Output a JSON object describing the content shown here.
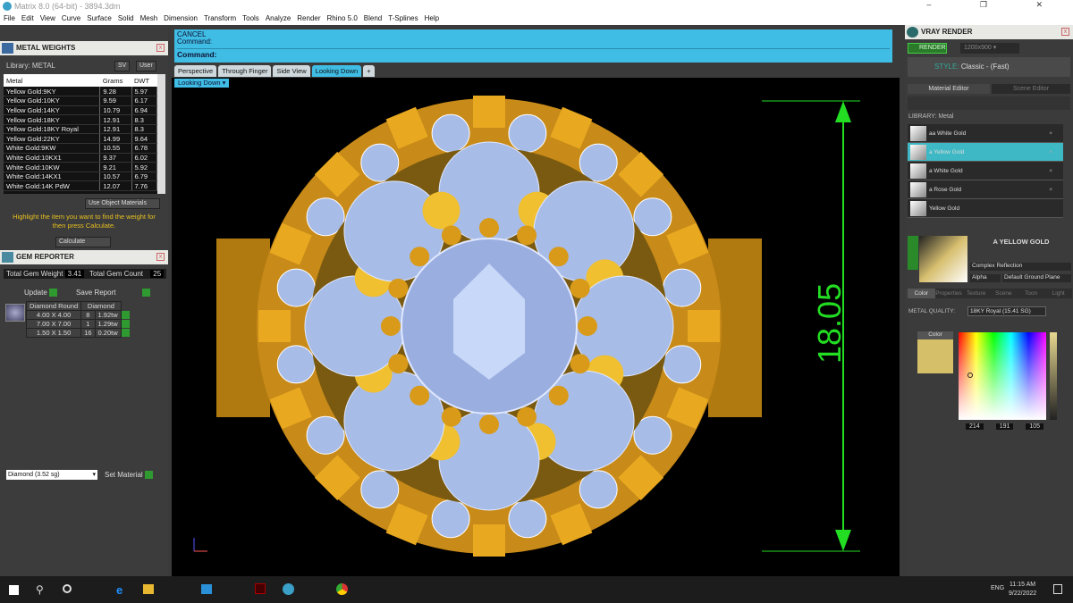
{
  "window": {
    "title": "Matrix 8.0 (64-bit) - 3894.3dm",
    "controls": "– ❐ ✕"
  },
  "menu": [
    "File",
    "Edit",
    "View",
    "Curve",
    "Surface",
    "Solid",
    "Mesh",
    "Dimension",
    "Transform",
    "Tools",
    "Analyze",
    "Render",
    "Rhino 5.0",
    "Blend",
    "T-Splines",
    "Help"
  ],
  "metal_weights": {
    "title": "METAL WEIGHTS",
    "library": "Library: METAL",
    "sv": "SV",
    "user": "User",
    "columns": [
      "Metal",
      "Grams",
      "DWT"
    ],
    "rows": [
      [
        "Yellow Gold:9KY",
        "9.28",
        "5.97"
      ],
      [
        "Yellow Gold:10KY",
        "9.59",
        "6.17"
      ],
      [
        "Yellow Gold:14KY",
        "10.79",
        "6.94"
      ],
      [
        "Yellow Gold:18KY",
        "12.91",
        "8.3"
      ],
      [
        "Yellow Gold:18KY Royal",
        "12.91",
        "8.3"
      ],
      [
        "Yellow Gold:22KY",
        "14.99",
        "9.64"
      ],
      [
        "White Gold:9KW",
        "10.55",
        "6.78"
      ],
      [
        "White Gold:10KX1",
        "9.37",
        "6.02"
      ],
      [
        "White Gold:10KW",
        "9.21",
        "5.92"
      ],
      [
        "White Gold:14KX1",
        "10.57",
        "6.79"
      ],
      [
        "White Gold:14K PdW",
        "12.07",
        "7.76"
      ]
    ],
    "use_object_materials": "Use Object Materials",
    "hint": "Highlight the item you want to find the weight for then press Calculate.",
    "calculate": "Calculate"
  },
  "gem_reporter": {
    "title": "GEM REPORTER",
    "total_weight_label": "Total Gem Weight",
    "total_weight": "3.41",
    "total_count_label": "Total Gem Count",
    "total_count": "25",
    "update": "Update",
    "save_report": "Save Report",
    "header": [
      "Diamond Round",
      "Diamond"
    ],
    "rows": [
      [
        "4.00 X 4.00",
        "8",
        "1.92tw"
      ],
      [
        "7.00 X 7.00",
        "1",
        "1.29tw"
      ],
      [
        "1.50 X 1.50",
        "16",
        "0.20tw"
      ]
    ],
    "material_select": "Diamond   (3.52 sg)",
    "set_material": "Set Material"
  },
  "command": {
    "line1": "CANCEL",
    "line2": "Command:",
    "prompt": "Command:"
  },
  "view_tabs": [
    "Perspective",
    "Through Finger",
    "Side View",
    "Looking Down"
  ],
  "active_tab": "Looking Down",
  "viewport": {
    "label": "Looking Down",
    "dimension": "18.05",
    "dimension_color": "#22dd22"
  },
  "vray": {
    "title": "VRAY RENDER",
    "render": "RENDER",
    "resolution": "1200x900",
    "style_label": "STYLE:",
    "style": "Classic - (Fast)",
    "tabs": [
      "Material Editor",
      "Scene Editor"
    ],
    "library": "LIBRARY: Metal",
    "sv": "SV",
    "user": "User",
    "materials": [
      "aa White Gold",
      "a Yellow Gold",
      "a White Gold",
      "a Rose Gold",
      "Yellow Gold"
    ],
    "selected_material": "A YELLOW GOLD",
    "reflection": "Complex Reflection",
    "alpha": "Alpha",
    "ground": "Default Ground Plane",
    "sub_tabs": [
      "Color",
      "Properties",
      "Texture",
      "Scene",
      "Toon",
      "Light"
    ],
    "metal_quality_label": "METAL QUALITY:",
    "metal_quality": "18KY Royal     (15.41 SG)",
    "color_label": "Color",
    "swatch": "#d6bf69",
    "r": "214",
    "g": "191",
    "b": "105"
  },
  "taskbar": {
    "lang": "ENG",
    "time": "11:15 AM",
    "date": "9/22/2022"
  }
}
